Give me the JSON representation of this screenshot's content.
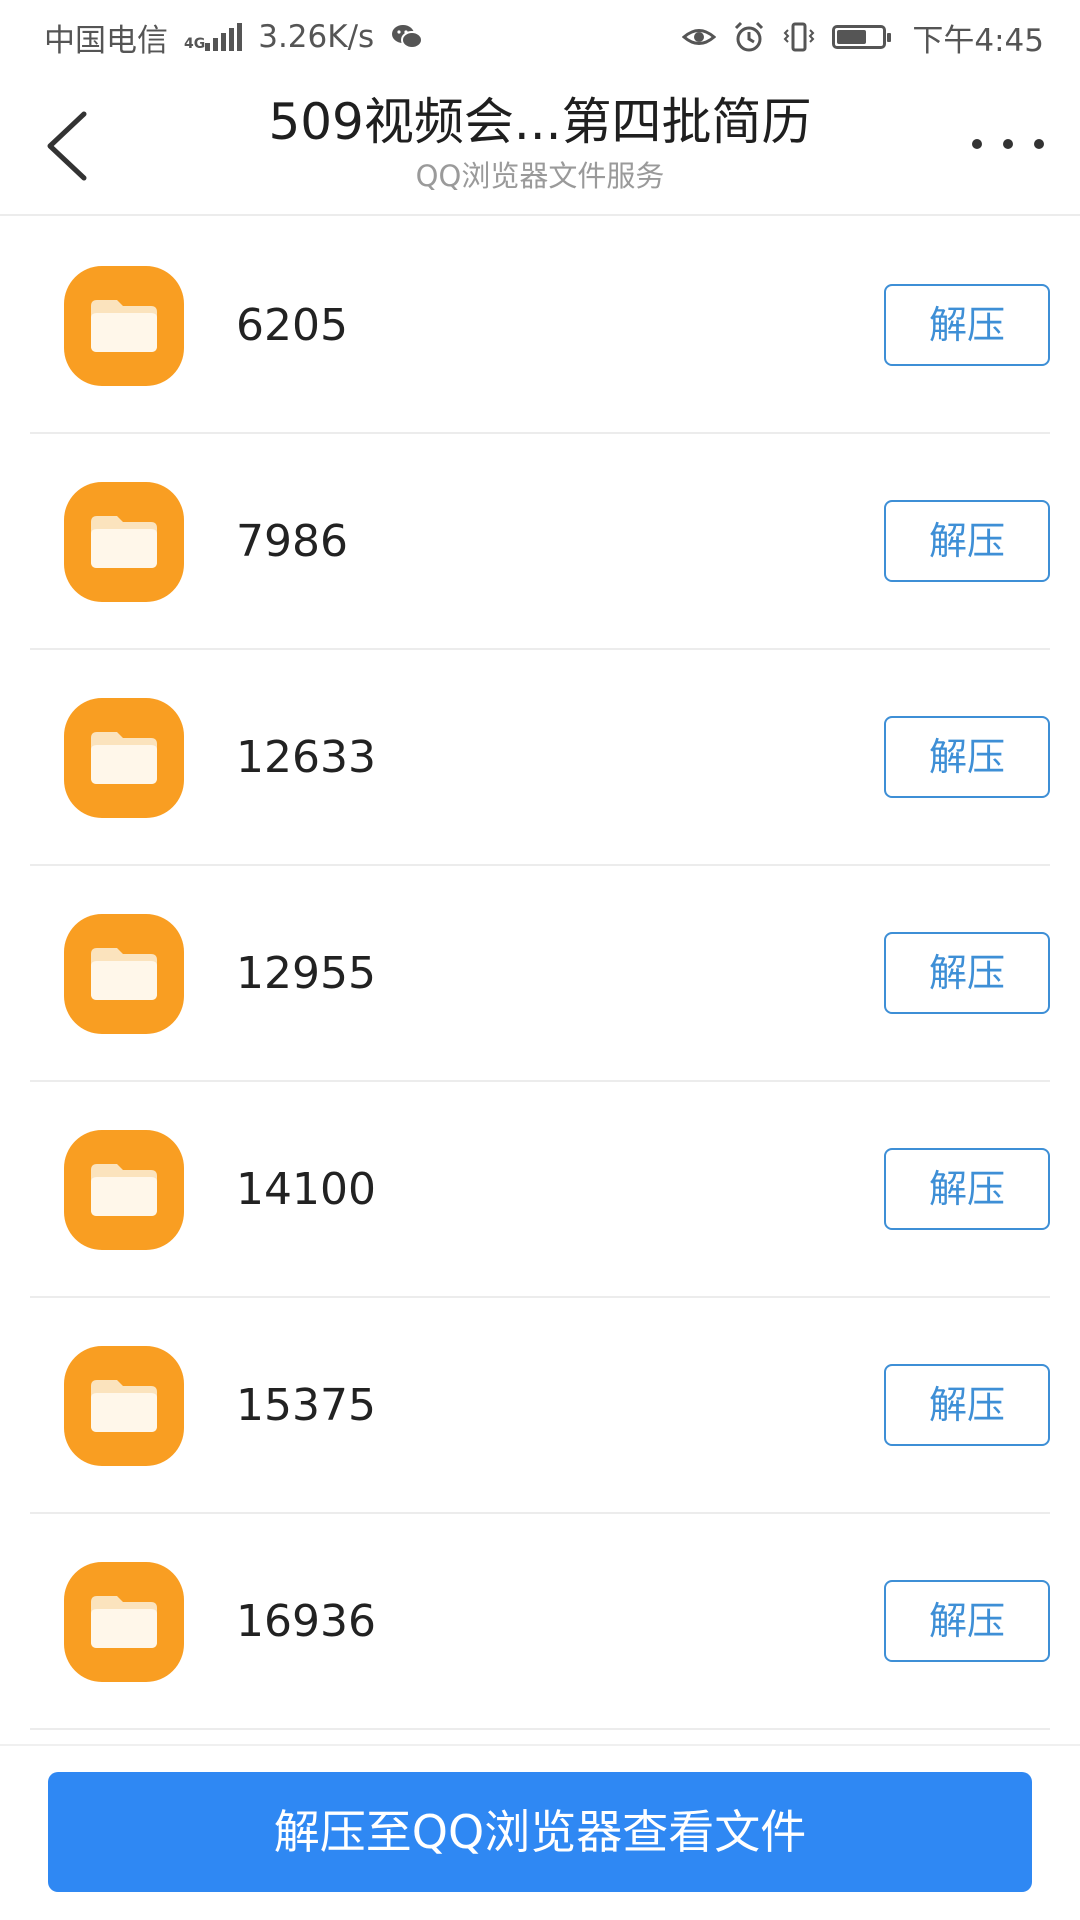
{
  "status_bar": {
    "carrier": "中国电信",
    "network": "4G",
    "speed": "3.26K/s",
    "time": "下午4:45",
    "icons": [
      "wechat-icon",
      "eye-icon",
      "alarm-icon",
      "vibrate-icon",
      "battery-icon"
    ]
  },
  "header": {
    "title": "509视频会...第四批简历",
    "subtitle": "QQ浏览器文件服务"
  },
  "files": [
    {
      "name": "6205",
      "action": "解压"
    },
    {
      "name": "7986",
      "action": "解压"
    },
    {
      "name": "12633",
      "action": "解压"
    },
    {
      "name": "12955",
      "action": "解压"
    },
    {
      "name": "14100",
      "action": "解压"
    },
    {
      "name": "15375",
      "action": "解压"
    },
    {
      "name": "16936",
      "action": "解压"
    }
  ],
  "bottom": {
    "primary_label": "解压至QQ浏览器查看文件"
  },
  "colors": {
    "folder": "#f99e22",
    "accent": "#3e8fd6",
    "primary_button": "#2f88f3"
  }
}
